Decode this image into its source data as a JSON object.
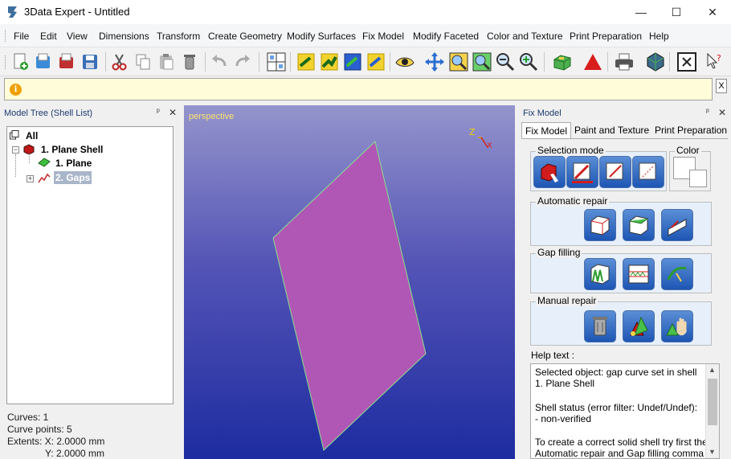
{
  "window": {
    "title": "3Data Expert - Untitled",
    "controls": [
      "minimize-icon",
      "maximize-icon",
      "close-icon"
    ],
    "minimize_glyph": "—",
    "maximize_glyph": "☐",
    "close_glyph": "✕"
  },
  "menu": [
    "File",
    "Edit",
    "View",
    "Dimensions",
    "Transform",
    "Create Geometry",
    "Modify Surfaces",
    "Fix Model",
    "Modify Faceted",
    "Color and Texture",
    "Print Preparation",
    "Help"
  ],
  "toolbar": {
    "buttons": [
      "new-icon",
      "open-icon",
      "import-icon",
      "save-icon",
      "cut-icon",
      "copy-icon",
      "paste-icon",
      "delete-icon",
      "undo-icon",
      "redo-icon",
      "view-layout-icon",
      "create-plane-icon",
      "create-plane-2-icon",
      "create-plane-3-icon",
      "create-plane-4-icon",
      "eye-icon",
      "pan-icon",
      "zoom-window-icon",
      "zoom-fit-icon",
      "zoom-out-icon",
      "zoom-in-icon",
      "box-icon",
      "triangle-icon",
      "print-icon",
      "render-icon",
      "clear-icon",
      "help-pointer-icon"
    ]
  },
  "infobar": {
    "icon": "info-icon",
    "close_label": "X"
  },
  "model_tree": {
    "title": "Model Tree (Shell List)",
    "pin_glyph": "ᵖ",
    "close_glyph": "✕",
    "items": [
      {
        "label": "All",
        "icon": "tree-root-icon"
      },
      {
        "label": "1. Plane Shell",
        "icon": "shell-icon",
        "expander": "−"
      },
      {
        "label": "1. Plane",
        "icon": "plane-icon"
      },
      {
        "label": "2. Gaps",
        "icon": "gaps-icon",
        "expander": "+",
        "selected": true
      }
    ]
  },
  "status": {
    "curves": "Curves: 1",
    "curve_points": "Curve points: 5",
    "extents_x": "Extents:   X: 2.0000 mm",
    "extents_y": "Y: 2.0000 mm"
  },
  "viewport": {
    "label": "perspective",
    "axis_z": "Z",
    "axis_x": "X",
    "plane_fill": "#b057b6",
    "plane_edge": "#8be08b"
  },
  "fix_panel": {
    "title": "Fix Model",
    "tabs": [
      "Fix Model",
      "Paint and Texture",
      "Print Preparation"
    ],
    "selection_mode_label": "Selection mode",
    "color_label": "Color",
    "automatic_repair_label": "Automatic repair",
    "gap_filling_label": "Gap filling",
    "manual_repair_label": "Manual repair",
    "help_label": "Help text :",
    "help_lines": [
      "Selected object: gap curve set in shell",
      "1. Plane Shell",
      "",
      "Shell status (error filter: Undef/Undef):",
      "- non-verified",
      "",
      "To create a correct solid shell try first the",
      "Automatic repair and Gap filling comma"
    ],
    "scroll_up": "▲",
    "scroll_down": "▼"
  },
  "colors": {
    "accent": "#1d56b4",
    "viewport_top": "#9494cc",
    "viewport_bottom": "#1d2ca0",
    "panel_bg": "#f0f0f0",
    "info_bg": "#fffdd9"
  }
}
